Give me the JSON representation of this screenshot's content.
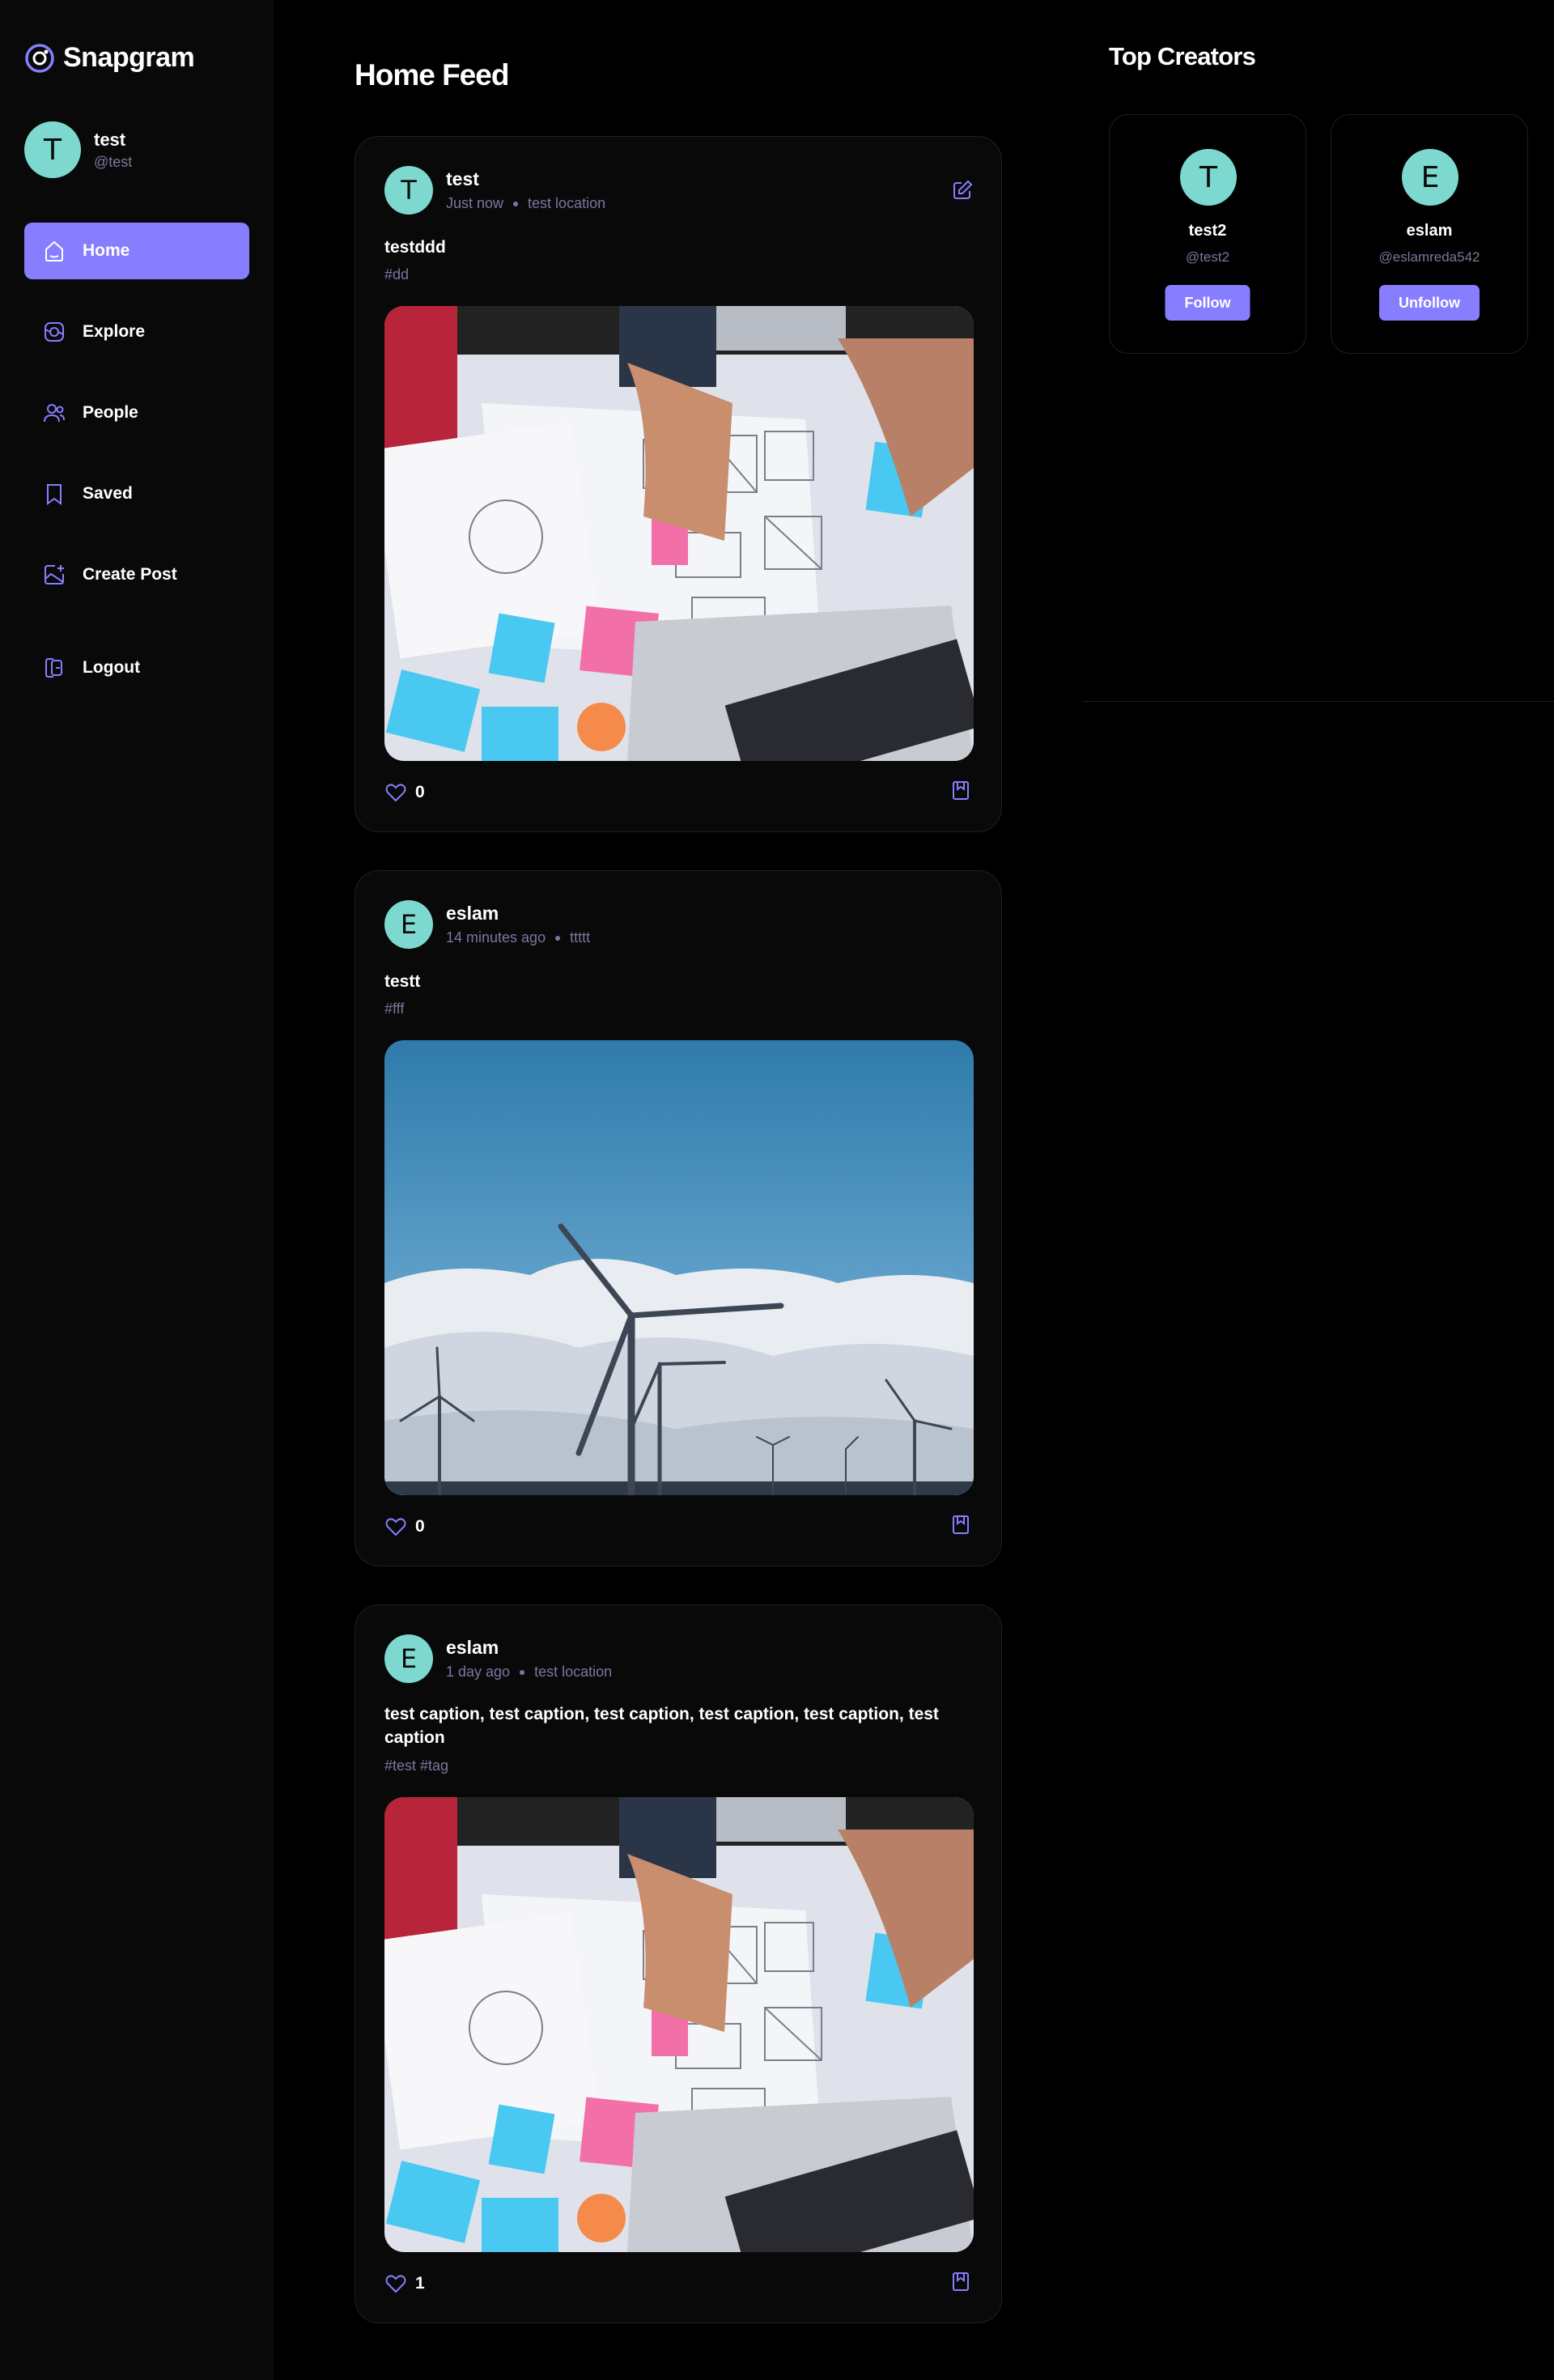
{
  "app": {
    "name": "Snapgram",
    "accent": "#877eff",
    "avatar_color": "#7dd8cf"
  },
  "user": {
    "initial": "T",
    "name": "test",
    "handle": "@test"
  },
  "nav": [
    {
      "id": "home",
      "label": "Home",
      "icon": "home-icon",
      "active": true
    },
    {
      "id": "explore",
      "label": "Explore",
      "icon": "explore-icon"
    },
    {
      "id": "people",
      "label": "People",
      "icon": "people-icon"
    },
    {
      "id": "saved",
      "label": "Saved",
      "icon": "bookmark-icon"
    },
    {
      "id": "create",
      "label": "Create Post",
      "icon": "create-post-icon"
    },
    {
      "id": "logout",
      "label": "Logout",
      "icon": "logout-icon"
    }
  ],
  "feed": {
    "title": "Home Feed",
    "posts": [
      {
        "initial": "T",
        "author": "test",
        "time": "Just now",
        "location": "test location",
        "caption": "testddd",
        "tags": "#dd",
        "likes": "0",
        "image": "whiteboard-sketch-photo",
        "editable": true
      },
      {
        "initial": "E",
        "author": "eslam",
        "time": "14 minutes ago",
        "location": "ttttt",
        "caption": "testt",
        "tags": "#fff",
        "likes": "0",
        "image": "wind-turbines-photo",
        "editable": false
      },
      {
        "initial": "E",
        "author": "eslam",
        "time": "1 day ago",
        "location": "test location",
        "caption": "test caption, test caption, test caption, test caption, test caption, test caption",
        "tags": "#test #tag",
        "likes": "1",
        "image": "whiteboard-sketch-photo",
        "editable": false
      }
    ]
  },
  "top_creators": {
    "title": "Top Creators",
    "creators": [
      {
        "initial": "T",
        "name": "test2",
        "handle": "@test2",
        "action": "Follow"
      },
      {
        "initial": "E",
        "name": "eslam",
        "handle": "@eslamreda542",
        "action": "Unfollow"
      }
    ]
  }
}
